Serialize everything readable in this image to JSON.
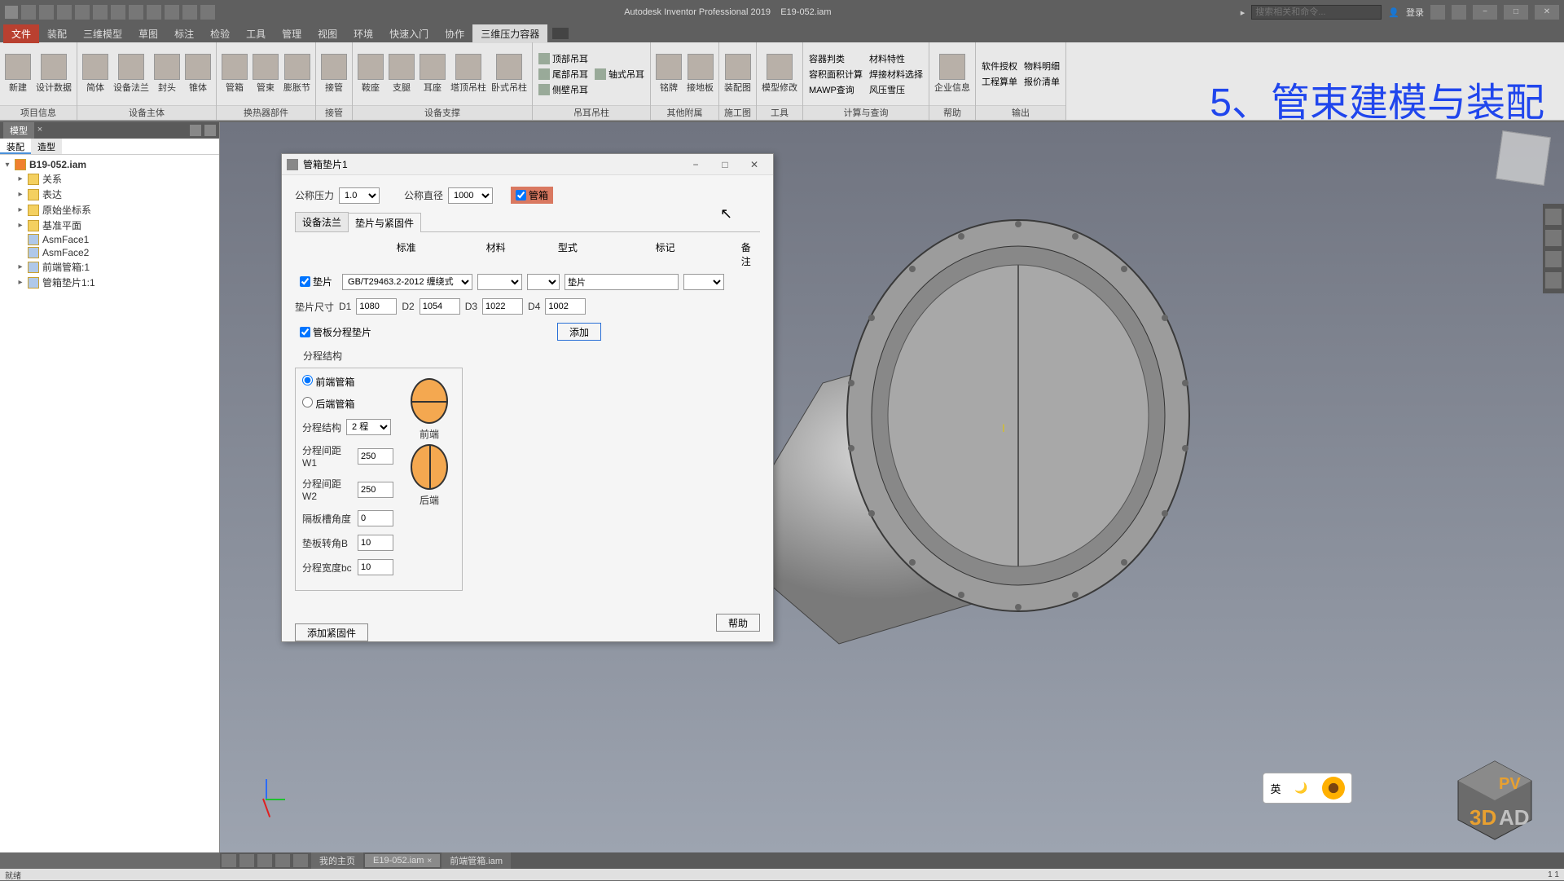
{
  "app": {
    "title": "Autodesk Inventor Professional 2019",
    "document": "E19-052.iam",
    "search_placeholder": "搜索相关和命令...",
    "login": "登录"
  },
  "overlay": "5、管束建模与装配",
  "menu": {
    "file": "文件",
    "tabs": [
      "装配",
      "三维模型",
      "草图",
      "标注",
      "检验",
      "工具",
      "管理",
      "视图",
      "环境",
      "快速入门",
      "协作",
      "三维压力容器"
    ]
  },
  "ribbon": {
    "g1": {
      "label": "项目信息",
      "new": "新建",
      "design": "设计数据"
    },
    "g2": {
      "label": "设备主体",
      "items": [
        "简体",
        "设备法兰",
        "封头",
        "锥体"
      ]
    },
    "g3": {
      "label": "换热器部件",
      "items": [
        "管箱",
        "管束",
        "膨胀节"
      ]
    },
    "g4": {
      "label": "接管",
      "items": [
        "接管"
      ]
    },
    "g5": {
      "label": "设备支撑",
      "items": [
        "鞍座",
        "支腿",
        "耳座",
        "塔顶吊柱",
        "卧式吊柱"
      ]
    },
    "g6": {
      "label": "吊耳吊柱",
      "items": [
        "顶部吊耳",
        "尾部吊耳",
        "侧壁吊耳",
        "轴式吊耳"
      ]
    },
    "g7": {
      "label": "其他附属",
      "items": [
        "铭牌",
        "接地板"
      ]
    },
    "g8": {
      "label": "施工图",
      "items": [
        "装配图"
      ]
    },
    "g9": {
      "label": "工具",
      "items": [
        "模型修改"
      ]
    },
    "g10": {
      "label": "计算与查询",
      "items": [
        "容器判类",
        "材料特性",
        "焊接材料选择",
        "容积面积计算",
        "MAWP查询",
        "风压雪压"
      ]
    },
    "g11": {
      "label": "帮助",
      "items": [
        "企业信息"
      ]
    },
    "g12": {
      "label": "输出",
      "items": [
        "软件授权",
        "工程算单",
        "物料明细",
        "报价清单"
      ]
    }
  },
  "browser": {
    "panel_tab": "模型",
    "sub_tabs": [
      "装配",
      "造型"
    ],
    "root": "B19-052.iam",
    "items": [
      "关系",
      "表达",
      "原始坐标系",
      "基准平面",
      "AsmFace1",
      "AsmFace2",
      "前端管箱:1",
      "管箱垫片1:1"
    ]
  },
  "dialog": {
    "title": "管箱垫片1",
    "nom_pressure_lbl": "公称压力",
    "nom_pressure_val": "1.0",
    "nom_dia_lbl": "公称直径",
    "nom_dia_val": "1000",
    "pipe_box_chk": "管箱",
    "tabs": [
      "设备法兰",
      "垫片与紧固件"
    ],
    "headers": {
      "std": "标准",
      "mat": "材料",
      "type": "型式",
      "mark": "标记",
      "note": "备注"
    },
    "gasket_chk": "垫片",
    "gasket_std": "GB/T29463.2-2012 缠绕式",
    "mark_val": "垫片",
    "size_lbl": "垫片尺寸",
    "d1_lbl": "D1",
    "d1": "1080",
    "d2_lbl": "D2",
    "d2": "1054",
    "d3_lbl": "D3",
    "d3": "1022",
    "d4_lbl": "D4",
    "d4": "1002",
    "partition_chk": "管板分程垫片",
    "add_btn": "添加",
    "struct_header": "分程结构",
    "front_radio": "前端管箱",
    "rear_radio": "后端管箱",
    "front_lbl": "前端",
    "rear_lbl": "后端",
    "pass_lbl": "分程结构",
    "pass_val": "2 程",
    "w1_lbl": "分程间距W1",
    "w1": "250",
    "w2_lbl": "分程间距W2",
    "w2": "250",
    "angle_lbl": "隔板槽角度",
    "angle": "0",
    "rot_lbl": "垫板转角B",
    "rot": "10",
    "width_lbl": "分程宽度bc",
    "width": "10",
    "add_fastener": "添加紧固件",
    "help": "帮助"
  },
  "bottom": {
    "mypage": "我的主页",
    "doc1": "E19-052.iam",
    "doc2": "前端管箱.iam"
  },
  "status": {
    "left": "就绪",
    "right": "1   1"
  },
  "ime": "英"
}
